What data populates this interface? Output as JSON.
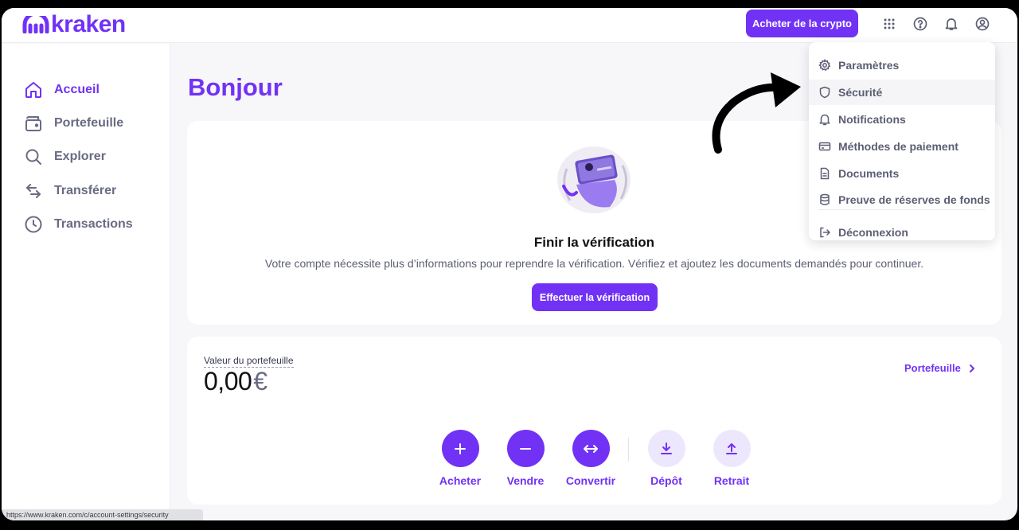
{
  "brand": {
    "name": "kraken",
    "color": "#7132f5"
  },
  "topbar": {
    "buy_label": "Acheter de la crypto",
    "icons": [
      "apps-grid-icon",
      "help-icon",
      "bell-icon",
      "user-icon"
    ]
  },
  "sidebar": {
    "items": [
      {
        "label": "Accueil",
        "icon": "home-icon",
        "active": true
      },
      {
        "label": "Portefeuille",
        "icon": "wallet-icon",
        "active": false
      },
      {
        "label": "Explorer",
        "icon": "search-icon",
        "active": false
      },
      {
        "label": "Transférer",
        "icon": "transfer-icon",
        "active": false
      },
      {
        "label": "Transactions",
        "icon": "clock-icon",
        "active": false
      }
    ]
  },
  "main": {
    "title": "Bonjour",
    "verification": {
      "title": "Finir la vérification",
      "description": "Votre compte nécessite plus d’informations pour reprendre la vérification. Vérifiez et ajoutez les documents demandés pour continuer.",
      "button": "Effectuer la vérification"
    },
    "wallet": {
      "label": "Valeur du portefeuille",
      "amount": "0,00",
      "currency": "€",
      "link": "Portefeuille",
      "actions": [
        {
          "label": "Acheter",
          "icon": "plus-icon"
        },
        {
          "label": "Vendre",
          "icon": "minus-icon"
        },
        {
          "label": "Convertir",
          "icon": "convert-icon"
        },
        {
          "label": "Dépôt",
          "icon": "deposit-icon"
        },
        {
          "label": "Retrait",
          "icon": "withdraw-icon"
        }
      ]
    }
  },
  "account_menu": {
    "items": [
      {
        "label": "Paramètres",
        "icon": "gear-icon"
      },
      {
        "label": "Sécurité",
        "icon": "shield-icon"
      },
      {
        "label": "Notifications",
        "icon": "bell-icon"
      },
      {
        "label": "Méthodes de paiement",
        "icon": "credit-card-icon"
      },
      {
        "label": "Documents",
        "icon": "document-icon"
      },
      {
        "label": "Preuve de réserves de fonds",
        "icon": "database-icon"
      },
      {
        "label": "Déconnexion",
        "icon": "logout-icon"
      }
    ]
  },
  "status_url": "https://www.kraken.com/c/account-settings/security"
}
